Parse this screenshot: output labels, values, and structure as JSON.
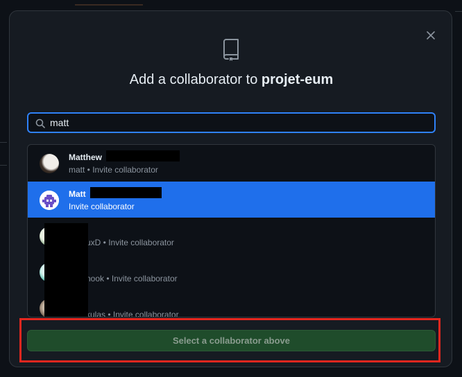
{
  "dialog": {
    "title_prefix": "Add a collaborator to ",
    "repo_name": "projet-eum",
    "close_icon": "close-icon",
    "repo_icon": "repo-icon"
  },
  "search": {
    "value": "matt",
    "icon": "search-icon"
  },
  "results": [
    {
      "name": "Matthew",
      "sub": "matt • Invite collaborator",
      "avatar": "photo"
    },
    {
      "name": "Matt",
      "sub": "Invite collaborator",
      "avatar": "robot-icon",
      "selected": true
    },
    {
      "name": "",
      "sub": "uxD • Invite collaborator",
      "avatar": "photo"
    },
    {
      "name": "",
      "sub": "nook • Invite collaborator",
      "avatar": "photo"
    },
    {
      "name": "",
      "sub": "kulas • Invite collaborator",
      "avatar": "photo"
    }
  ],
  "footer": {
    "select_button_label": "Select a collaborator above"
  },
  "colors": {
    "accent": "#2f81f7",
    "selected_row": "#1f6feb",
    "primary_button": "#1f4c2b",
    "highlight": "#e5271f"
  }
}
